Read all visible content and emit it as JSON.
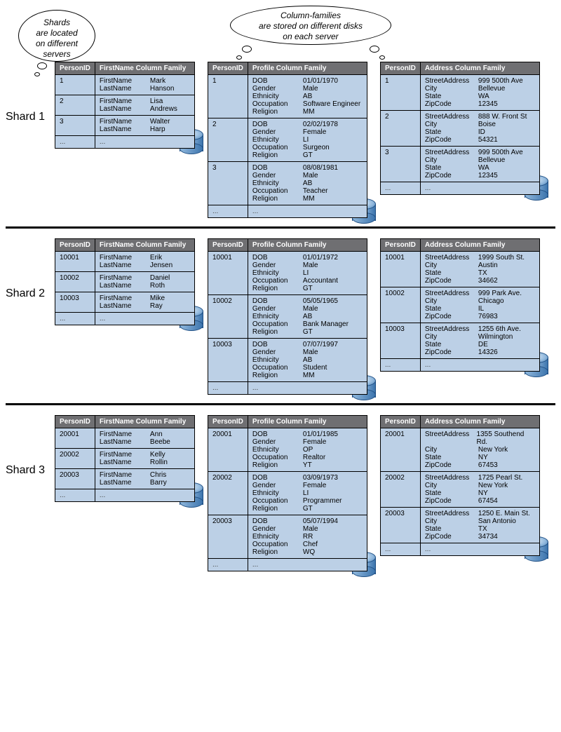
{
  "bubbles": {
    "shard": "Shards\nare located\non different\nservers",
    "cf": "Column-families\nare stored on different disks\non each server"
  },
  "headers": {
    "id": "PersonID",
    "name_cf": "FirstName Column Family",
    "profile_cf": "Profile Column Family",
    "address_cf": "Address Column Family"
  },
  "labels": {
    "name": {
      "FirstName": "FirstName",
      "LastName": "LastName"
    },
    "profile": {
      "DOB": "DOB",
      "Gender": "Gender",
      "Ethnicity": "Ethnicity",
      "Occupation": "Occupation",
      "Religion": "Religion"
    },
    "address": {
      "StreetAddress": "StreetAddress",
      "City": "City",
      "State": "State",
      "ZipCode": "ZipCode"
    }
  },
  "ellipsis": "...",
  "shards": [
    {
      "label": "Shard 1",
      "rows": [
        {
          "id": "1",
          "name": {
            "FirstName": "Mark",
            "LastName": "Hanson"
          },
          "profile": {
            "DOB": "01/01/1970",
            "Gender": "Male",
            "Ethnicity": "AB",
            "Occupation": "Software Engineer",
            "Religion": "MM"
          },
          "address": {
            "StreetAddress": "999 500th Ave",
            "City": "Bellevue",
            "State": "WA",
            "ZipCode": "12345"
          }
        },
        {
          "id": "2",
          "name": {
            "FirstName": "Lisa",
            "LastName": "Andrews"
          },
          "profile": {
            "DOB": "02/02/1978",
            "Gender": "Female",
            "Ethnicity": "LI",
            "Occupation": "Surgeon",
            "Religion": "GT"
          },
          "address": {
            "StreetAddress": "888 W. Front St",
            "City": "Boise",
            "State": "ID",
            "ZipCode": "54321"
          }
        },
        {
          "id": "3",
          "name": {
            "FirstName": "Walter",
            "LastName": "Harp"
          },
          "profile": {
            "DOB": "08/08/1981",
            "Gender": "Male",
            "Ethnicity": "AB",
            "Occupation": "Teacher",
            "Religion": "MM"
          },
          "address": {
            "StreetAddress": "999 500th Ave",
            "City": "Bellevue",
            "State": "WA",
            "ZipCode": "12345"
          }
        }
      ]
    },
    {
      "label": "Shard 2",
      "rows": [
        {
          "id": "10001",
          "name": {
            "FirstName": "Erik",
            "LastName": "Jensen"
          },
          "profile": {
            "DOB": "01/01/1972",
            "Gender": "Male",
            "Ethnicity": "LI",
            "Occupation": "Accountant",
            "Religion": "GT"
          },
          "address": {
            "StreetAddress": "1999 South St.",
            "City": "Austin",
            "State": "TX",
            "ZipCode": "34662"
          }
        },
        {
          "id": "10002",
          "name": {
            "FirstName": "Daniel",
            "LastName": "Roth"
          },
          "profile": {
            "DOB": "05/05/1965",
            "Gender": "Male",
            "Ethnicity": "AB",
            "Occupation": "Bank Manager",
            "Religion": "GT"
          },
          "address": {
            "StreetAddress": "999 Park Ave.",
            "City": "Chicago",
            "State": "IL",
            "ZipCode": "76983"
          }
        },
        {
          "id": "10003",
          "name": {
            "FirstName": "Mike",
            "LastName": "Ray"
          },
          "profile": {
            "DOB": "07/07/1997",
            "Gender": "Male",
            "Ethnicity": "AB",
            "Occupation": "Student",
            "Religion": "MM"
          },
          "address": {
            "StreetAddress": "1255 6th Ave.",
            "City": "Wilmington",
            "State": "DE",
            "ZipCode": "14326"
          }
        }
      ]
    },
    {
      "label": "Shard 3",
      "rows": [
        {
          "id": "20001",
          "name": {
            "FirstName": "Ann",
            "LastName": "Beebe"
          },
          "profile": {
            "DOB": "01/01/1985",
            "Gender": "Female",
            "Ethnicity": "OP",
            "Occupation": "Realtor",
            "Religion": "YT"
          },
          "address": {
            "StreetAddress": "1355 Southend Rd.",
            "City": "New York",
            "State": "NY",
            "ZipCode": "67453"
          }
        },
        {
          "id": "20002",
          "name": {
            "FirstName": "Kelly",
            "LastName": "Rollin"
          },
          "profile": {
            "DOB": "03/09/1973",
            "Gender": "Female",
            "Ethnicity": "LI",
            "Occupation": "Programmer",
            "Religion": "GT"
          },
          "address": {
            "StreetAddress": "1725 Pearl St.",
            "City": "New York",
            "State": "NY",
            "ZipCode": "67454"
          }
        },
        {
          "id": "20003",
          "name": {
            "FirstName": "Chris",
            "LastName": "Barry"
          },
          "profile": {
            "DOB": "05/07/1994",
            "Gender": "Male",
            "Ethnicity": "RR",
            "Occupation": "Chef",
            "Religion": "WQ"
          },
          "address": {
            "StreetAddress": "1250 E. Main St.",
            "City": "San Antonio",
            "State": "TX",
            "ZipCode": "34734"
          }
        }
      ]
    }
  ]
}
